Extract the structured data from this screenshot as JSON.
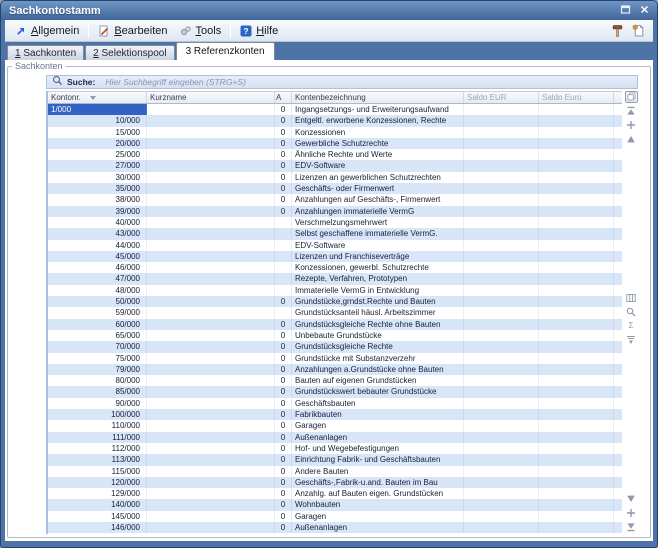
{
  "window": {
    "title": "Sachkontostamm"
  },
  "titlebar": {
    "buttons": [
      "restore",
      "close"
    ]
  },
  "menubar": {
    "items": [
      {
        "label": "Allgemein",
        "underline": 0,
        "icon": "arrow-up-right",
        "separator_after": true
      },
      {
        "label": "Bearbeiten",
        "underline": 0,
        "icon": "edit-page",
        "separator_after": false
      },
      {
        "label": "Tools",
        "underline": 0,
        "icon": "gear",
        "separator_after": true
      },
      {
        "label": "Hilfe",
        "underline": 0,
        "icon": "help",
        "separator_after": false
      }
    ],
    "right_icons": [
      "hammer",
      "new-document"
    ]
  },
  "tabs": [
    {
      "label": "1 Sachkonten",
      "underline": 0,
      "active": false
    },
    {
      "label": "2 Selektionspool",
      "underline": 0,
      "active": false
    },
    {
      "label": "3 Referenzkonten",
      "underline": -1,
      "active": true
    }
  ],
  "groupbox": {
    "label": "Sachkonten"
  },
  "search": {
    "label": "Suche:",
    "placeholder": "Hier Suchbegriff eingeben (STRG+S)"
  },
  "table": {
    "columns": [
      {
        "key": "kontonr",
        "label": "Kontonr.",
        "sort": "desc",
        "muted": false
      },
      {
        "key": "kurzname",
        "label": "Kurzname",
        "sort": null,
        "muted": false
      },
      {
        "key": "a",
        "label": "A",
        "sort": null,
        "muted": false
      },
      {
        "key": "bez",
        "label": "Kontenbezeichnung",
        "sort": null,
        "muted": false
      },
      {
        "key": "eur",
        "label": "Saldo EUR",
        "sort": null,
        "muted": true
      },
      {
        "key": "euro",
        "label": "Saldo Euro",
        "sort": null,
        "muted": true
      }
    ],
    "selected_cell": {
      "row": 0,
      "column": "kontonr"
    },
    "rows": [
      [
        "1/000",
        "",
        "0",
        "Ingangsetzungs- und Erweiterungsaufwand",
        "",
        ""
      ],
      [
        "10/000",
        "",
        "0",
        "Entgeltl. erworbene Konzessionen, Rechte",
        "",
        ""
      ],
      [
        "15/000",
        "",
        "0",
        "Konzessionen",
        "",
        ""
      ],
      [
        "20/000",
        "",
        "0",
        "Gewerbliche Schutzrechte",
        "",
        ""
      ],
      [
        "25/000",
        "",
        "0",
        "Ähnliche Rechte und Werte",
        "",
        ""
      ],
      [
        "27/000",
        "",
        "0",
        "EDV-Software",
        "",
        ""
      ],
      [
        "30/000",
        "",
        "0",
        "Lizenzen an gewerblichen Schutzrechten",
        "",
        ""
      ],
      [
        "35/000",
        "",
        "0",
        "Geschäfts- oder Firmenwert",
        "",
        ""
      ],
      [
        "38/000",
        "",
        "0",
        "Anzahlungen auf Geschäfts-, Firmenwert",
        "",
        ""
      ],
      [
        "39/000",
        "",
        "0",
        "Anzahlungen immaterielle VermG",
        "",
        ""
      ],
      [
        "40/000",
        "",
        "",
        "Verschmelzungsmehrwert",
        "",
        ""
      ],
      [
        "43/000",
        "",
        "",
        "Selbst geschaffene immaterielle VermG.",
        "",
        ""
      ],
      [
        "44/000",
        "",
        "",
        "EDV-Software",
        "",
        ""
      ],
      [
        "45/000",
        "",
        "",
        "Lizenzen und Franchiseverträge",
        "",
        ""
      ],
      [
        "46/000",
        "",
        "",
        "Konzessionen, gewerbl. Schutzrechte",
        "",
        ""
      ],
      [
        "47/000",
        "",
        "",
        "Rezepte, Verfahren, Prototypen",
        "",
        ""
      ],
      [
        "48/000",
        "",
        "",
        "Immaterielle VermG in Entwicklung",
        "",
        ""
      ],
      [
        "50/000",
        "",
        "0",
        "Grundstücke,grndst.Rechte und Bauten",
        "",
        ""
      ],
      [
        "59/000",
        "",
        "",
        "Grundstücksanteil häusl. Arbeitszimmer",
        "",
        ""
      ],
      [
        "60/000",
        "",
        "0",
        "Grundstücksgleiche Rechte ohne Bauten",
        "",
        ""
      ],
      [
        "65/000",
        "",
        "0",
        "Unbebaute Grundstücke",
        "",
        ""
      ],
      [
        "70/000",
        "",
        "0",
        "Grundstücksgleiche Rechte",
        "",
        ""
      ],
      [
        "75/000",
        "",
        "0",
        "Grundstücke mit Substanzverzehr",
        "",
        ""
      ],
      [
        "79/000",
        "",
        "0",
        "Anzahlungen a.Grundstücke ohne Bauten",
        "",
        ""
      ],
      [
        "80/000",
        "",
        "0",
        "Bauten auf eigenen Grundstücken",
        "",
        ""
      ],
      [
        "85/000",
        "",
        "0",
        "Grundstückswert bebauter Grundstücke",
        "",
        ""
      ],
      [
        "90/000",
        "",
        "0",
        "Geschäftsbauten",
        "",
        ""
      ],
      [
        "100/000",
        "",
        "0",
        "Fabrikbauten",
        "",
        ""
      ],
      [
        "110/000",
        "",
        "0",
        "Garagen",
        "",
        ""
      ],
      [
        "111/000",
        "",
        "0",
        "Außenanlagen",
        "",
        ""
      ],
      [
        "112/000",
        "",
        "0",
        "Hof- und Wegebefestigungen",
        "",
        ""
      ],
      [
        "113/000",
        "",
        "0",
        "Einrichtung Fabrik- und Geschäftsbauten",
        "",
        ""
      ],
      [
        "115/000",
        "",
        "0",
        "Andere Bauten",
        "",
        ""
      ],
      [
        "120/000",
        "",
        "0",
        "Geschäfts-,Fabrik-u.and. Bauten im Bau",
        "",
        ""
      ],
      [
        "129/000",
        "",
        "0",
        "Anzahlg. auf Bauten eigen. Grundstücken",
        "",
        ""
      ],
      [
        "140/000",
        "",
        "0",
        "Wohnbauten",
        "",
        ""
      ],
      [
        "145/000",
        "",
        "0",
        "Garagen",
        "",
        ""
      ],
      [
        "146/000",
        "",
        "0",
        "Außenanlagen",
        "",
        ""
      ]
    ]
  },
  "rail_icons": {
    "header": "column-chooser",
    "top": [
      "scroll-to-top",
      "scroll-position-up",
      "scroll-up"
    ],
    "middle": [
      "columns",
      "zoom",
      "sum",
      "filter"
    ],
    "bottom": [
      "scroll-down",
      "scroll-position-down",
      "scroll-to-bottom"
    ]
  },
  "colors": {
    "titlebar": "#4e73a7",
    "selection": "#3162c4",
    "row_stripe": "#d8e6f8",
    "accent_orange": "#e8962e"
  }
}
